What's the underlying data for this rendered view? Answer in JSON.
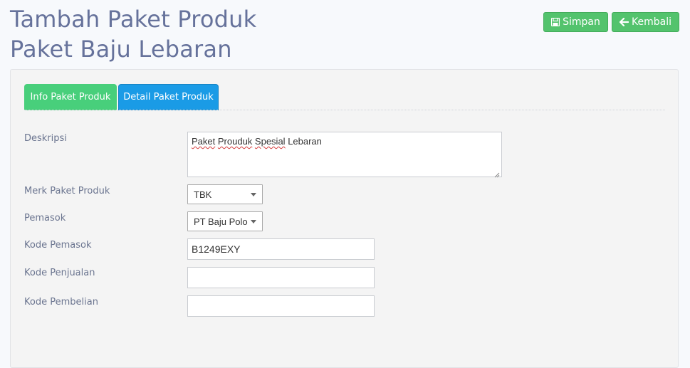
{
  "header": {
    "title_line1": "Tambah Paket Produk",
    "title_line2": "Paket Baju Lebaran"
  },
  "actions": {
    "save_label": "Simpan",
    "save_icon": "floppy-disk-icon",
    "back_label": "Kembali",
    "back_icon": "arrow-left-icon",
    "button_color": "#53c36d"
  },
  "tabs": [
    {
      "label": "Info Paket Produk",
      "color": "#48cf7b"
    },
    {
      "label": "Detail Paket Produk",
      "color": "#1a9be6",
      "active": true
    }
  ],
  "form": {
    "deskripsi": {
      "label": "Deskripsi",
      "words": [
        "Paket",
        "Prouduk",
        "Spesial",
        "Lebaran"
      ]
    },
    "merk": {
      "label": "Merk Paket Produk",
      "value": "TBK"
    },
    "pemasok": {
      "label": "Pemasok",
      "value": "PT Baju Polo"
    },
    "kode_pemasok": {
      "label": "Kode Pemasok",
      "value": "B1249EXY"
    },
    "kode_penjualan": {
      "label": "Kode Penjualan",
      "value": ""
    },
    "kode_pembelian": {
      "label": "Kode Pembelian",
      "value": ""
    }
  }
}
